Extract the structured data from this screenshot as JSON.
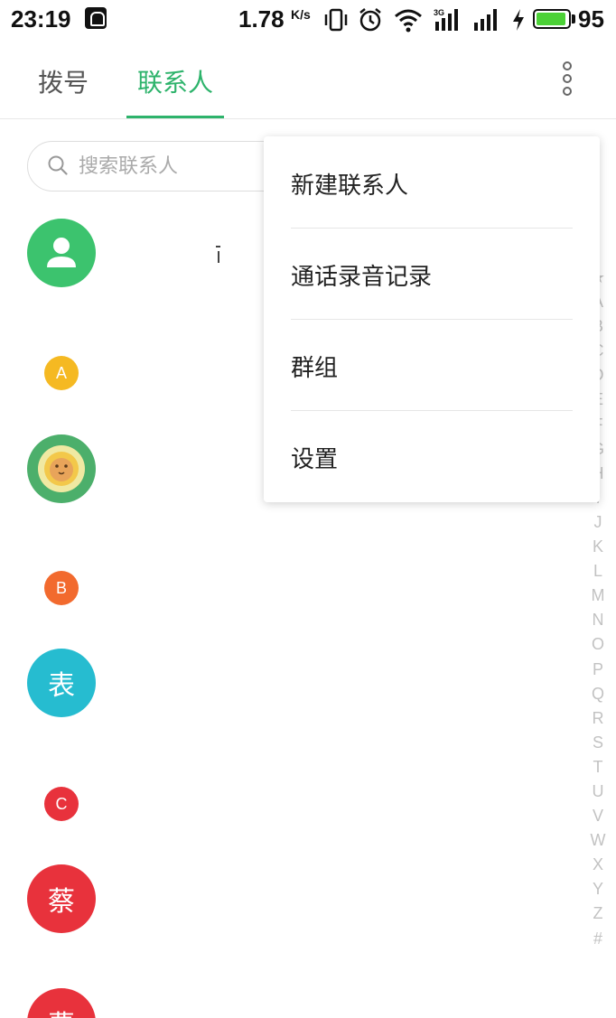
{
  "status_bar": {
    "time": "23:19",
    "net_speed": "1.78",
    "net_speed_unit": "K/s",
    "network_type": "3G",
    "battery_level": "95",
    "battery_fraction": 0.95,
    "battery_color": "#4cd137"
  },
  "tabs": [
    {
      "label": "拨号",
      "active": false
    },
    {
      "label": "联系人",
      "active": true
    }
  ],
  "accent_color": "#2db36b",
  "search": {
    "placeholder": "搜索联系人"
  },
  "contacts": [
    {
      "type": "avatar",
      "icon": "person-icon",
      "color": "#3cc36e"
    },
    {
      "type": "section",
      "letter": "A",
      "color": "#f5b922"
    },
    {
      "type": "avatar",
      "icon": "lion-avatar-icon",
      "color": "#4caf6b"
    },
    {
      "type": "section",
      "letter": "B",
      "color": "#f26a2e"
    },
    {
      "type": "avatar",
      "text": "表",
      "color": "#26bcd0"
    },
    {
      "type": "section",
      "letter": "C",
      "color": "#e8323c"
    },
    {
      "type": "avatar",
      "text": "蔡",
      "color": "#e8323c"
    },
    {
      "type": "avatar",
      "text": "曹",
      "color": "#e8323c"
    }
  ],
  "alpha_index": [
    "★",
    "A",
    "B",
    "C",
    "D",
    "E",
    "F",
    "G",
    "H",
    "I",
    "J",
    "K",
    "L",
    "M",
    "N",
    "O",
    "P",
    "Q",
    "R",
    "S",
    "T",
    "U",
    "V",
    "W",
    "X",
    "Y",
    "Z",
    "#"
  ],
  "menu": {
    "items": [
      {
        "label": "新建联系人"
      },
      {
        "label": "通话录音记录"
      },
      {
        "label": "群组"
      },
      {
        "label": "设置"
      }
    ]
  }
}
